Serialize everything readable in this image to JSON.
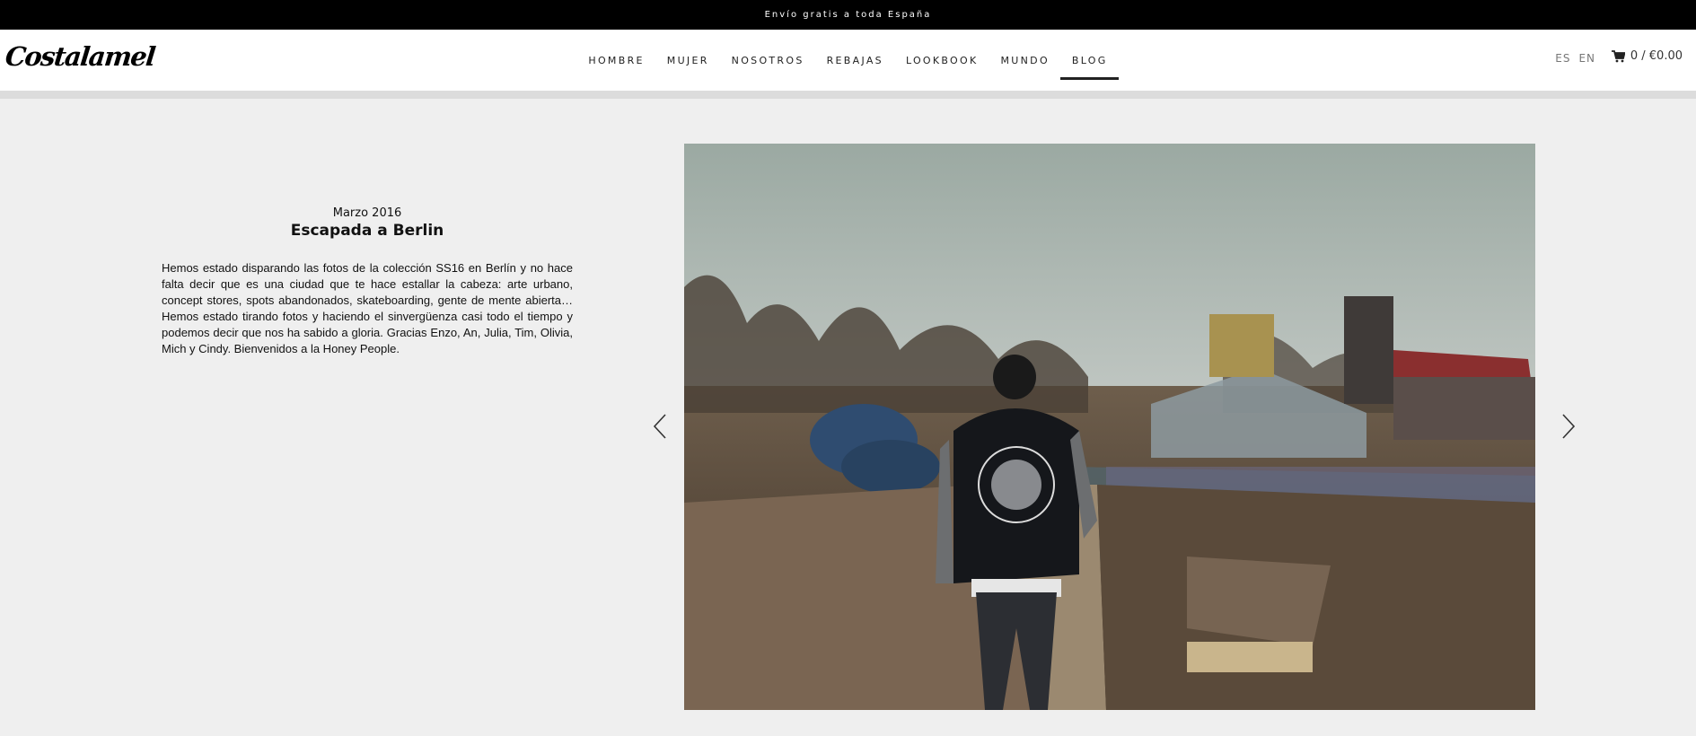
{
  "announcement": "Envío gratis a toda España",
  "brand": {
    "logo_text": "Costalamel"
  },
  "nav": {
    "items": [
      {
        "label": "HOMBRE",
        "active": false
      },
      {
        "label": "MUJER",
        "active": false
      },
      {
        "label": "NOSOTROS",
        "active": false
      },
      {
        "label": "REBAJAS",
        "active": false
      },
      {
        "label": "LOOKBOOK",
        "active": false
      },
      {
        "label": "MUNDO",
        "active": false
      },
      {
        "label": "BLOG",
        "active": true
      }
    ]
  },
  "languages": {
    "es": "ES",
    "en": "EN"
  },
  "cart": {
    "label": "0 / €0.00",
    "icon": "cart-icon"
  },
  "post": {
    "date": "Marzo 2016",
    "title": "Escapada a Berlin",
    "body": "Hemos estado disparando las fotos de la colección SS16 en Berlín y no hace falta decir que es una ciudad que te hace estallar la cabeza: arte urbano, concept stores, spots abandonados, skateboarding, gente de mente abierta… Hemos estado tirando fotos y haciendo el sinvergüenza casi todo el tiempo y podemos decir que nos ha sabido a gloria. Gracias Enzo, An, Julia, Tim, Olivia, Mich y Cindy. Bienvenidos a la Honey People."
  },
  "slider": {
    "prev_icon": "chevron-left-icon",
    "next_icon": "chevron-right-icon"
  },
  "colors": {
    "topbar": "#000000",
    "background": "#efefef",
    "header": "#ffffff"
  }
}
